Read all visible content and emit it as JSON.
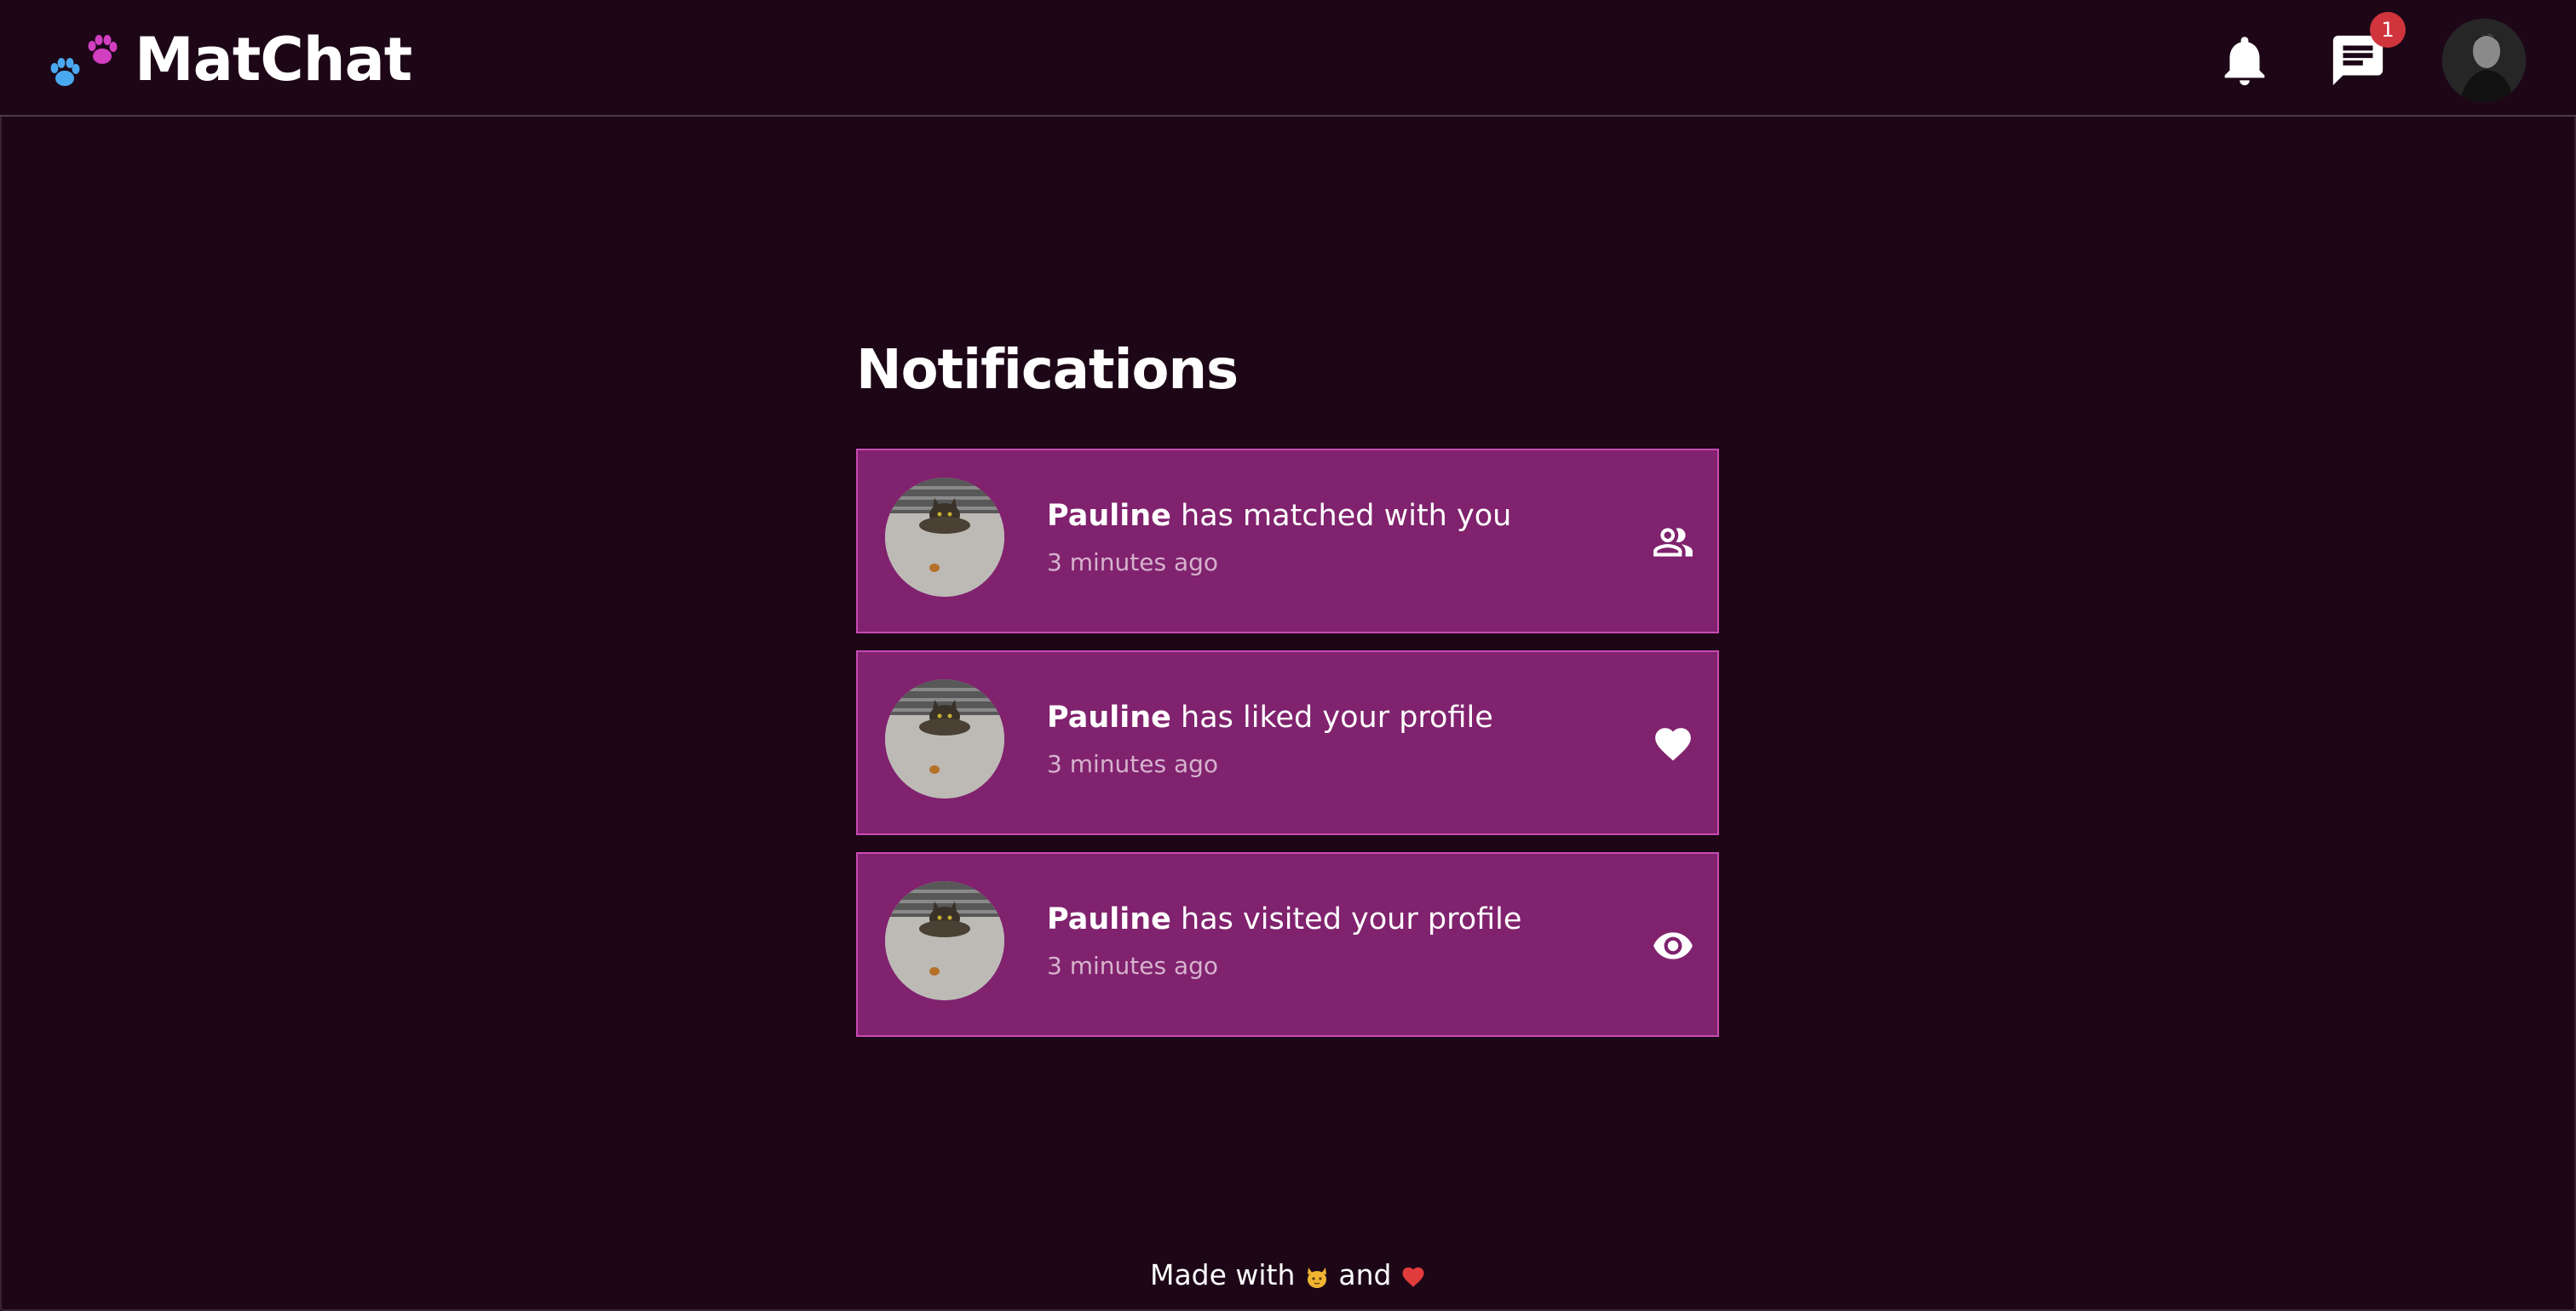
{
  "app": {
    "name": "MatChat",
    "logo_icon": "paw-icons"
  },
  "header": {
    "notifications_icon": "bell-icon",
    "messages_icon": "chat-icon",
    "messages_badge": "1",
    "avatar_icon": "user-avatar"
  },
  "page": {
    "title": "Notifications"
  },
  "notifications": [
    {
      "name": "Pauline",
      "message": "has matched with you",
      "time": "3 minutes ago",
      "icon": "people-icon"
    },
    {
      "name": "Pauline",
      "message": "has liked your profile",
      "time": "3 minutes ago",
      "icon": "heart-icon"
    },
    {
      "name": "Pauline",
      "message": "has visited your profile",
      "time": "3 minutes ago",
      "icon": "eye-icon"
    }
  ],
  "footer": {
    "prefix": "Made with",
    "middle": "and",
    "cat_emoji": "🐱",
    "heart_emoji": "❤"
  },
  "colors": {
    "background": "#1d0717",
    "card": "#80226e",
    "card_border": "#c94ab4",
    "badge": "#d0343c",
    "paw_blue": "#4aa8f0",
    "paw_pink": "#d23ec0"
  }
}
